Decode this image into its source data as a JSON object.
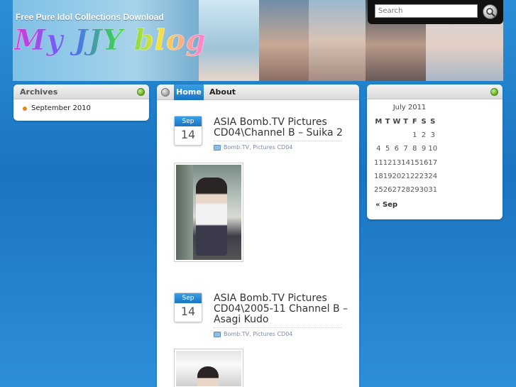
{
  "header": {
    "site_title": "Free Pure Idol Collections Download",
    "logo_text": "My JJY blog",
    "search_placeholder": "Search"
  },
  "archives": {
    "title": "Archives",
    "items": [
      {
        "label": "September 2010"
      }
    ]
  },
  "nav": {
    "items": [
      {
        "label": "Home",
        "active": true
      },
      {
        "label": "About",
        "active": false
      }
    ]
  },
  "posts": [
    {
      "month": "Sep",
      "day": "14",
      "title": "ASIA Bomb.TV Pictures CD04\\Channel B – Suika 2",
      "category": "Bomb.TV, Pictures CD04"
    },
    {
      "month": "Sep",
      "day": "14",
      "title": "ASIA Bomb.TV Pictures CD04\\2005-11 Channel B – Asagi Kudo",
      "category": "Bomb.TV, Pictures CD04"
    }
  ],
  "calendar": {
    "caption": "July 2011",
    "weekdays": [
      "M",
      "T",
      "W",
      "T",
      "F",
      "S",
      "S"
    ],
    "weeks": [
      [
        "",
        "",
        "",
        "",
        "1",
        "2",
        "3"
      ],
      [
        "4",
        "5",
        "6",
        "7",
        "8",
        "9",
        "10"
      ],
      [
        "11",
        "12",
        "13",
        "14",
        "15",
        "16",
        "17"
      ],
      [
        "18",
        "19",
        "20",
        "21",
        "22",
        "23",
        "24"
      ],
      [
        "25",
        "26",
        "27",
        "28",
        "29",
        "30",
        "31"
      ]
    ],
    "prev_label": "« Sep"
  },
  "colors": {
    "accent_blue": "#1a74c4",
    "bullet_orange": "#e88a1a",
    "widget_green": "#5eaa1f"
  }
}
